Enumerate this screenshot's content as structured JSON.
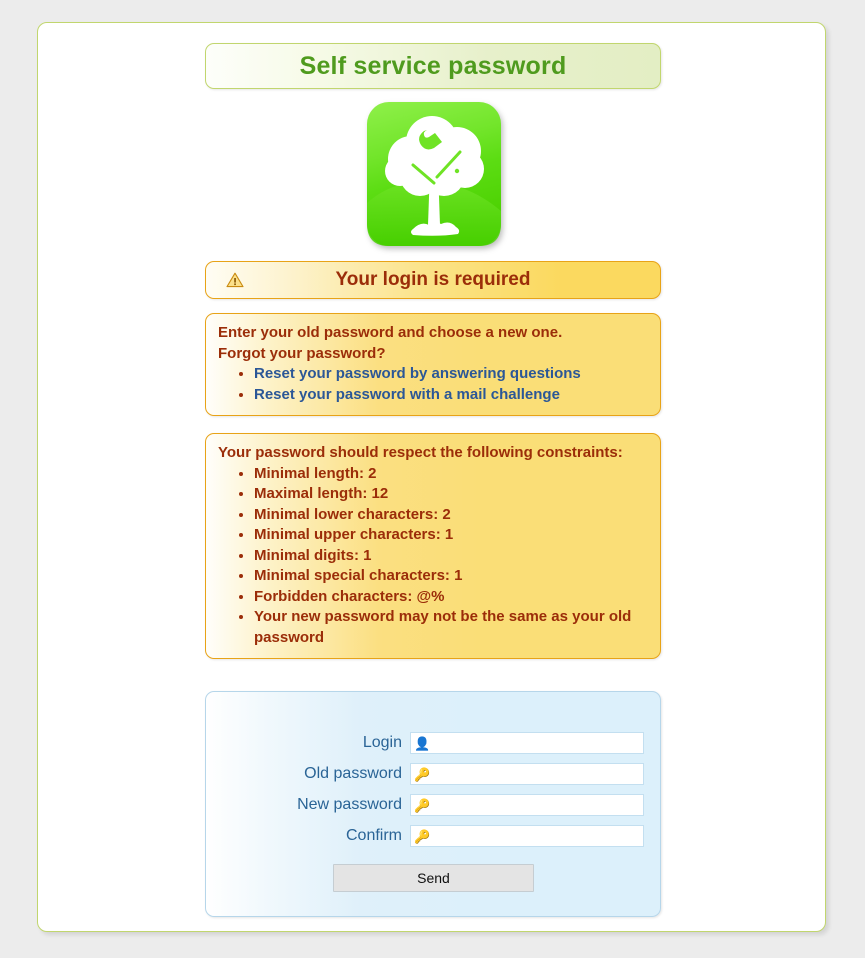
{
  "page": {
    "title": "Self service password",
    "background_color": "#ececec",
    "frame_border_color": "#c1d66e",
    "title_color": "#4f9b1e"
  },
  "logo": {
    "name": "ltb-tree-wrench-logo",
    "alt": "LDAP Tool Box tree and wrench logo",
    "background_color": "#5cdd13",
    "tree_color": "#ffffff"
  },
  "warning": {
    "icon": "warning-triangle-icon",
    "text": "Your login is required",
    "text_color": "#9b2d09",
    "border_color": "#e8a317"
  },
  "info": {
    "line1": "Enter your old password and choose a new one.",
    "line2": "Forgot your password?",
    "links": [
      {
        "label": "Reset your password by answering questions"
      },
      {
        "label": "Reset your password with a mail challenge"
      }
    ],
    "link_color": "#2b5797"
  },
  "constraints": {
    "heading": "Your password should respect the following constraints:",
    "items": [
      "Minimal length: 2",
      "Maximal length: 12",
      "Minimal lower characters: 2",
      "Minimal upper characters: 1",
      "Minimal digits: 1",
      "Minimal special characters: 1",
      "Forbidden characters: @%",
      "Your new password may not be the same as your old password"
    ]
  },
  "form": {
    "fields": [
      {
        "label": "Login",
        "icon": "user-icon",
        "glyph": "👤",
        "value": "",
        "placeholder": ""
      },
      {
        "label": "Old password",
        "icon": "key-icon",
        "glyph": "🔑",
        "value": "",
        "placeholder": ""
      },
      {
        "label": "New password",
        "icon": "key-icon",
        "glyph": "🔑",
        "value": "",
        "placeholder": ""
      },
      {
        "label": "Confirm",
        "icon": "key-icon",
        "glyph": "🔑",
        "value": "",
        "placeholder": ""
      }
    ],
    "submit_label": "Send",
    "label_color": "#2a6496",
    "panel_border_color": "#b6d6ea"
  }
}
